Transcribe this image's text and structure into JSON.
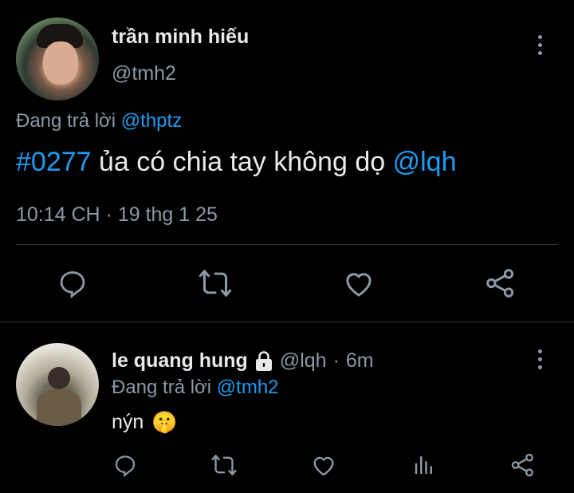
{
  "main_tweet": {
    "display_name": "trần minh hiếu",
    "handle": "@tmh2",
    "replying_prefix": "Đang trả lời",
    "replying_to": "@thptz",
    "hashtag": "#0277",
    "text": "ủa có chia tay không dọ",
    "mention": "@lqh",
    "timestamp": "10:14 CH · 19 thg 1 25"
  },
  "action_bar": {
    "icons": [
      "reply-icon",
      "retweet-icon",
      "like-icon",
      "share-icon"
    ]
  },
  "reply_tweet": {
    "display_name": "le quang hung",
    "protected_icon": "lock-icon",
    "handle": "@lqh",
    "separator": "·",
    "age": "6m",
    "replying_prefix": "Đang trả lời",
    "replying_to": "@tmh2",
    "text": "nýn",
    "emoji": "🤫",
    "icons": [
      "reply-icon",
      "retweet-icon",
      "like-icon",
      "views-icon",
      "share-icon"
    ]
  },
  "colors": {
    "background": "#000000",
    "text": "#e7e9ea",
    "muted": "#8b98a5",
    "link": "#1d9bf0",
    "divider": "#2f3336"
  }
}
